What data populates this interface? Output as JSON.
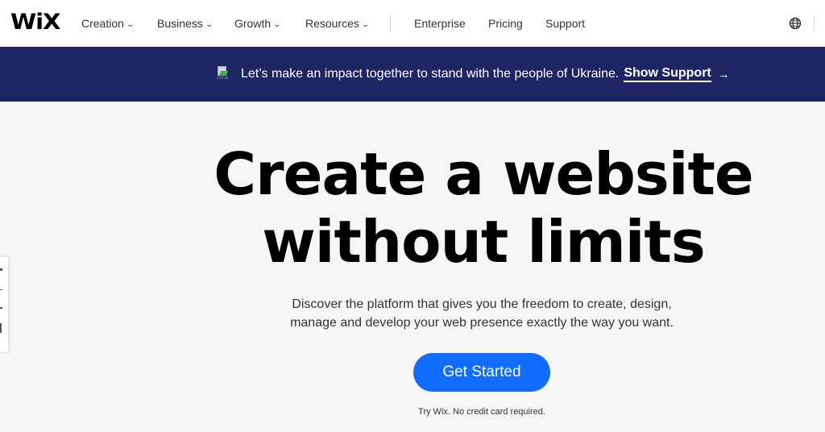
{
  "nav": {
    "logo": "WiX",
    "items": [
      {
        "label": "Creation",
        "has_dropdown": true
      },
      {
        "label": "Business",
        "has_dropdown": true
      },
      {
        "label": "Growth",
        "has_dropdown": true
      },
      {
        "label": "Resources",
        "has_dropdown": true
      },
      {
        "label": "Enterprise",
        "has_dropdown": false
      },
      {
        "label": "Pricing",
        "has_dropdown": false
      },
      {
        "label": "Support",
        "has_dropdown": false
      }
    ],
    "chevron": "⌄",
    "language_icon": "globe-icon"
  },
  "banner": {
    "image_alt": "Ukrai",
    "text": "Let’s make an impact together to stand with the people of Ukraine.",
    "link_label": "Show Support",
    "arrow": "→",
    "background": "#1d2563"
  },
  "hero": {
    "headline_line1": "Create a website",
    "headline_line2": "without limits",
    "subtext_line1": "Discover the platform that gives you the freedom to create, design,",
    "subtext_line2": "manage and develop your web presence exactly the way you want.",
    "cta_label": "Get Started",
    "cta_color": "#116dff",
    "cta_note": "Try Wix. No credit card required."
  }
}
